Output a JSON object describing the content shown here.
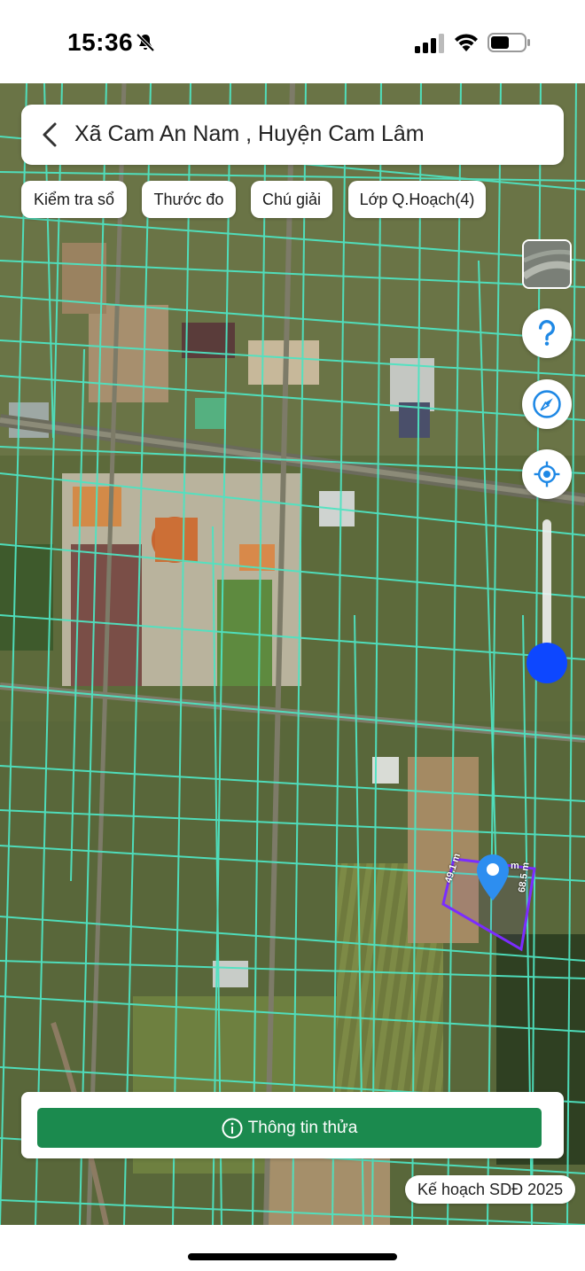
{
  "status_bar": {
    "time": "15:36",
    "icons": [
      "bell-slash-icon",
      "cellular-signal-icon",
      "wifi-icon",
      "battery-icon"
    ]
  },
  "header": {
    "title": "Xã Cam An Nam , Huyện Cam Lâm",
    "back_icon": "chevron-left-icon"
  },
  "toolbar": {
    "chips": [
      "Kiểm tra sổ",
      "Thước đo",
      "Chú giải",
      "Lớp Q.Hoạch(4)"
    ]
  },
  "map_controls": {
    "layer_icon": "satellite-layer-thumbnail",
    "help_icon": "question-icon",
    "compass_icon": "compass-icon",
    "locate_icon": "crosshair-locate-icon",
    "zoom_icon": "zoom-slider"
  },
  "parcel": {
    "edge_left": "49.1 m",
    "edge_right": "68.5 m",
    "edge_top": "m",
    "pin_icon": "location-pin-icon"
  },
  "bottom_card": {
    "button_label": "Thông tin thửa",
    "button_icon": "info-circle-icon"
  },
  "plan_badge": "Kế hoạch SDĐ 2025",
  "colors": {
    "parcel_lines": "#4fe3c1",
    "selected_parcel": "#7b2cff",
    "pin": "#2d8ef0",
    "primary_button": "#1b8a4e",
    "zoom_knob": "#0d47ff"
  }
}
